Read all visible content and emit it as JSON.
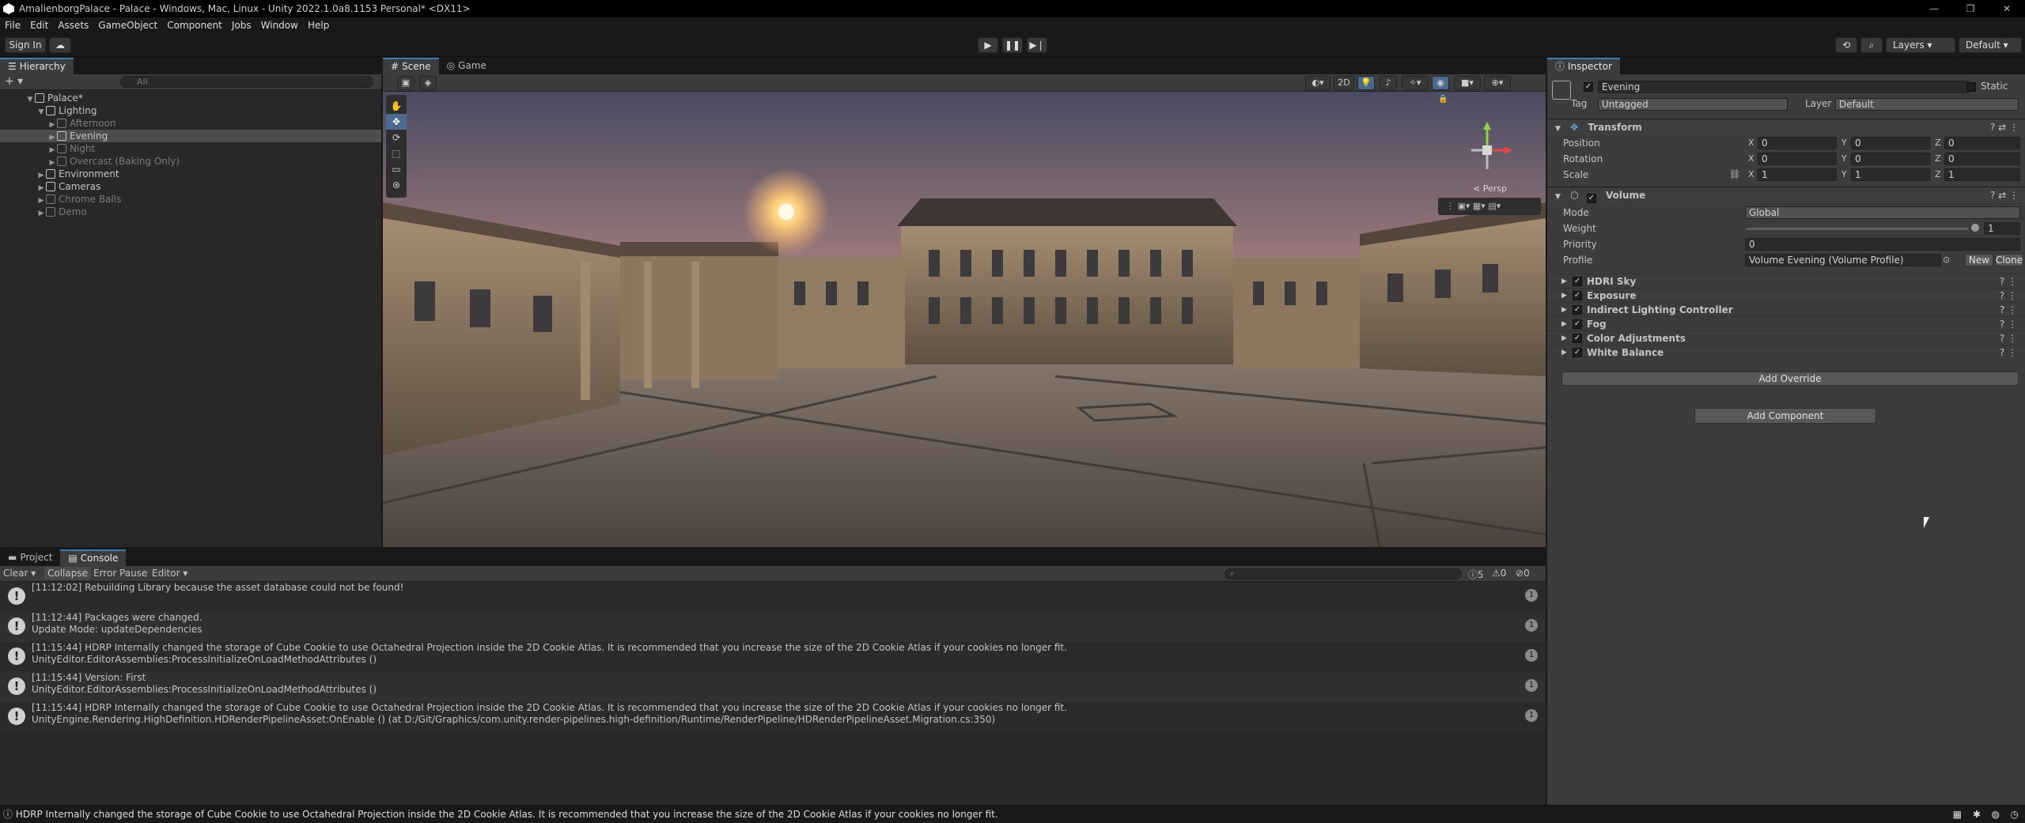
{
  "window": {
    "title": "AmalienborgPalace - Palace - Windows, Mac, Linux - Unity 2022.1.0a8.1153 Personal* <DX11>",
    "controls": [
      "—",
      "❐",
      "✕"
    ]
  },
  "menu": [
    "File",
    "Edit",
    "Assets",
    "GameObject",
    "Component",
    "Jobs",
    "Window",
    "Help"
  ],
  "toolbar": {
    "sign_in": "Sign In",
    "layers": "Layers",
    "layout": "Default"
  },
  "hierarchy": {
    "tab": "Hierarchy",
    "search_placeholder": "All",
    "items": [
      {
        "label": "Palace*",
        "indent": 0
      },
      {
        "label": "Lighting",
        "indent": 1
      },
      {
        "label": "Afternoon",
        "indent": 2
      },
      {
        "label": "Evening",
        "indent": 2
      },
      {
        "label": "Night",
        "indent": 2
      },
      {
        "label": "Overcast (Baking Only)",
        "indent": 2
      },
      {
        "label": "Environment",
        "indent": 1
      },
      {
        "label": "Cameras",
        "indent": 1
      },
      {
        "label": "Chrome Balls",
        "indent": 1
      },
      {
        "label": "Demo",
        "indent": 1
      }
    ]
  },
  "scene": {
    "tabs": [
      "Scene",
      "Game"
    ],
    "toggle_2d": "2D",
    "persp": "< Persp"
  },
  "bottom": {
    "tabs": [
      "Project",
      "Console"
    ],
    "clear": "Clear",
    "collapse": "Collapse",
    "error_pause": "Error Pause",
    "editor": "Editor",
    "counts": [
      "5",
      "0",
      "0"
    ],
    "logs": [
      {
        "line1": "[11:12:02] Rebuilding Library because the asset database could not be found!",
        "line2": "",
        "count": "1"
      },
      {
        "line1": "[11:12:44] Packages were changed.",
        "line2": "Update Mode: updateDependencies",
        "count": "1"
      },
      {
        "line1": "[11:15:44] HDRP Internally changed the storage of Cube Cookie to use Octahedral Projection inside the 2D Cookie Atlas. It is recommended that you increase the size of the 2D Cookie Atlas if your cookies no longer fit.",
        "line2": "UnityEditor.EditorAssemblies:ProcessInitializeOnLoadMethodAttributes ()",
        "count": "1"
      },
      {
        "line1": "[11:15:44] Version: First",
        "line2": "UnityEditor.EditorAssemblies:ProcessInitializeOnLoadMethodAttributes ()",
        "count": "1"
      },
      {
        "line1": "[11:15:44] HDRP Internally changed the storage of Cube Cookie to use Octahedral Projection inside the 2D Cookie Atlas. It is recommended that you increase the size of the 2D Cookie Atlas if your cookies no longer fit.",
        "line2": "UnityEngine.Rendering.HighDefinition.HDRenderPipelineAsset:OnEnable () (at D:/Git/Graphics/com.unity.render-pipelines.high-definition/Runtime/RenderPipeline/HDRenderPipelineAsset.Migration.cs:350)",
        "count": "1"
      }
    ]
  },
  "inspector": {
    "tab": "Inspector",
    "object_name": "Evening",
    "static": "Static",
    "tag_label": "Tag",
    "tag_value": "Untagged",
    "layer_label": "Layer",
    "layer_value": "Default",
    "transform": {
      "title": "Transform",
      "rows": [
        {
          "label": "Position",
          "x": "0",
          "y": "0",
          "z": "0"
        },
        {
          "label": "Rotation",
          "x": "0",
          "y": "0",
          "z": "0"
        },
        {
          "label": "Scale",
          "x": "1",
          "y": "1",
          "z": "1"
        }
      ]
    },
    "volume": {
      "title": "Volume",
      "mode_label": "Mode",
      "mode_value": "Global",
      "weight_label": "Weight",
      "weight_value": "1",
      "priority_label": "Priority",
      "priority_value": "0",
      "profile_label": "Profile",
      "profile_value": "Volume Evening (Volume Profile)",
      "new": "New",
      "clone": "Clone",
      "overrides": [
        "HDRI Sky",
        "Exposure",
        "Indirect Lighting Controller",
        "Fog",
        "Color Adjustments",
        "White Balance"
      ],
      "add_override": "Add Override"
    },
    "add_component": "Add Component"
  },
  "status": {
    "message": "HDRP Internally changed the storage of Cube Cookie to use Octahedral Projection inside the 2D Cookie Atlas. It is recommended that you increase the size of the 2D Cookie Atlas if your cookies no longer fit."
  }
}
